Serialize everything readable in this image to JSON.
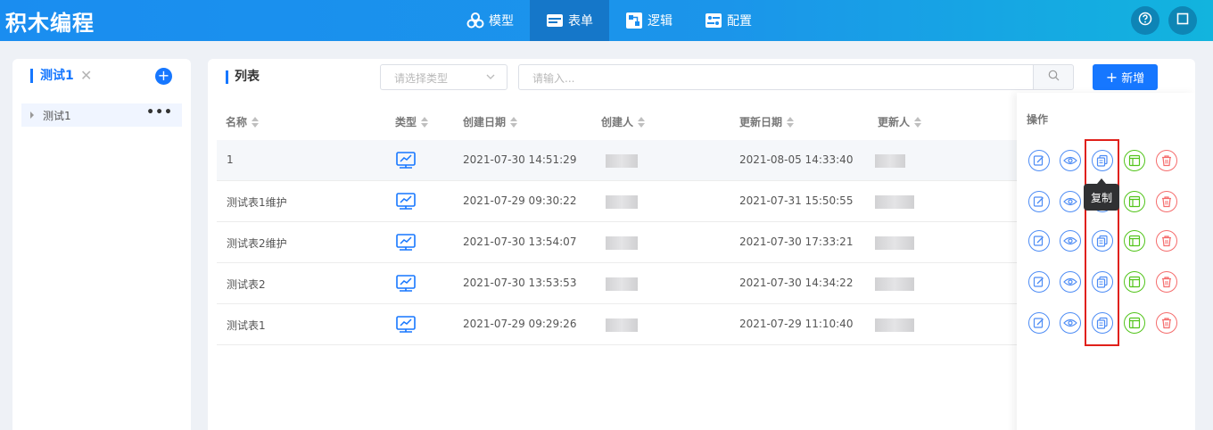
{
  "app": {
    "title": "积木编程"
  },
  "nav": [
    {
      "label": "模型",
      "icon": "cubes-icon",
      "active": false
    },
    {
      "label": "表单",
      "icon": "form-icon",
      "active": true
    },
    {
      "label": "逻辑",
      "icon": "logic-icon",
      "active": false
    },
    {
      "label": "配置",
      "icon": "config-icon",
      "active": false
    }
  ],
  "header_actions": {
    "help": "help-icon",
    "window": "window-icon"
  },
  "sidebar": {
    "title": "测试1",
    "tree": [
      {
        "label": "测试1"
      }
    ]
  },
  "main": {
    "title": "列表",
    "type_select": {
      "placeholder": "请选择类型"
    },
    "search": {
      "placeholder": "请输入..."
    },
    "add_label": "新增",
    "columns": [
      "名称",
      "类型",
      "创建日期",
      "创建人",
      "更新日期",
      "更新人"
    ],
    "ops_title": "操作",
    "rows": [
      {
        "name": "1",
        "created": "2021-07-30 14:51:29",
        "updated": "2021-08-05 14:33:40"
      },
      {
        "name": "测试表1维护",
        "created": "2021-07-29 09:30:22",
        "updated": "2021-07-31 15:50:55"
      },
      {
        "name": "测试表2维护",
        "created": "2021-07-30 13:54:07",
        "updated": "2021-07-30 17:33:21"
      },
      {
        "name": "测试表2",
        "created": "2021-07-30 13:53:53",
        "updated": "2021-07-30 14:34:22"
      },
      {
        "name": "测试表1",
        "created": "2021-07-29 09:29:26",
        "updated": "2021-07-29 11:10:40"
      }
    ],
    "tooltip": "复制"
  },
  "colors": {
    "primary": "#1677ff",
    "success": "#52c41a",
    "danger": "#f56c6c",
    "highlight": "#e0201a"
  }
}
